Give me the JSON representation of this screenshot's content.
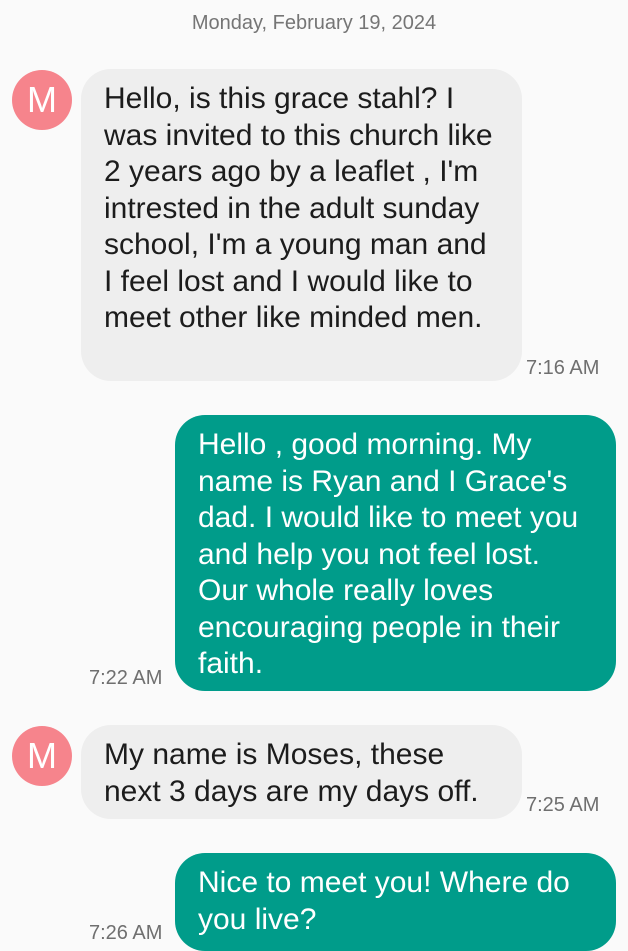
{
  "conversation": {
    "date": "Monday, February 19, 2024",
    "contact_initial": "M",
    "messages": [
      {
        "direction": "incoming",
        "text": "Hello, is this grace stahl? I was invited to this church like 2 years ago by a leaflet , I'm intrested in the adult sunday school, I'm a young man and I feel lost and I would like to meet other like minded men.",
        "time": "7:16 AM"
      },
      {
        "direction": "outgoing",
        "text": "Hello , good morning. My name is Ryan and I Grace's dad. I would like to meet you and help you not feel lost. Our whole really loves encouraging people in their faith.",
        "time": "7:22 AM"
      },
      {
        "direction": "incoming",
        "text": "My name is Moses, these next 3 days are my days off.",
        "time": "7:25 AM"
      },
      {
        "direction": "outgoing",
        "text": "Nice to meet you! Where do you live?",
        "time": "7:26 AM"
      }
    ]
  },
  "colors": {
    "incoming_bubble": "#eeeeee",
    "outgoing_bubble": "#009c8a",
    "avatar": "#f6848c",
    "background": "#fafafa"
  },
  "icons": {
    "avatar": "letter-avatar"
  }
}
